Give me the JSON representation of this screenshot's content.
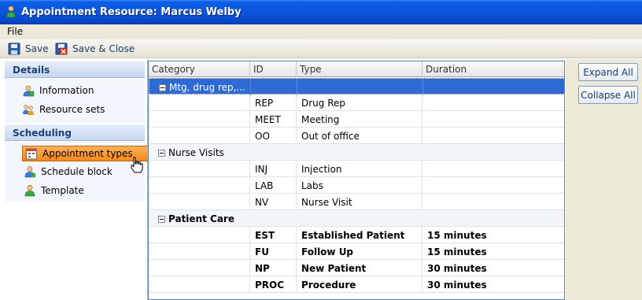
{
  "window": {
    "title": "Appointment Resource: Marcus Welby"
  },
  "menu": {
    "file": "File"
  },
  "toolbar": {
    "save": "Save",
    "save_close": "Save & Close"
  },
  "sidebar": {
    "details_header": "Details",
    "details_items": [
      {
        "label": "Information",
        "icon": "information-icon"
      },
      {
        "label": "Resource sets",
        "icon": "resource-sets-icon"
      }
    ],
    "scheduling_header": "Scheduling",
    "scheduling_items": [
      {
        "label": "Appointment types",
        "icon": "calendar-icon",
        "selected": true
      },
      {
        "label": "Schedule block",
        "icon": "schedule-block-icon"
      },
      {
        "label": "Template",
        "icon": "person-icon"
      }
    ]
  },
  "grid": {
    "columns": [
      "Category",
      "ID",
      "Type",
      "Duration"
    ],
    "groups": [
      {
        "name": "Mtg, drug rep,...",
        "bold": false,
        "selected": true,
        "rows": [
          {
            "id": "REP",
            "type": "Drug Rep",
            "duration": ""
          },
          {
            "id": "MEET",
            "type": "Meeting",
            "duration": ""
          },
          {
            "id": "OO",
            "type": "Out of office",
            "duration": ""
          }
        ]
      },
      {
        "name": "Nurse Visits",
        "bold": false,
        "selected": false,
        "rows": [
          {
            "id": "INJ",
            "type": "Injection",
            "duration": ""
          },
          {
            "id": "LAB",
            "type": "Labs",
            "duration": ""
          },
          {
            "id": "NV",
            "type": "Nurse Visit",
            "duration": ""
          }
        ]
      },
      {
        "name": "Patient Care",
        "bold": true,
        "selected": false,
        "rows": [
          {
            "id": "EST",
            "type": "Established Patient",
            "duration": "15 minutes"
          },
          {
            "id": "FU",
            "type": "Follow Up",
            "duration": "15 minutes"
          },
          {
            "id": "NP",
            "type": "New Patient",
            "duration": "30 minutes"
          },
          {
            "id": "PROC",
            "type": "Procedure",
            "duration": "30 minutes"
          }
        ]
      }
    ]
  },
  "actions": {
    "expand_all": "Expand All",
    "collapse_all": "Collapse All"
  }
}
